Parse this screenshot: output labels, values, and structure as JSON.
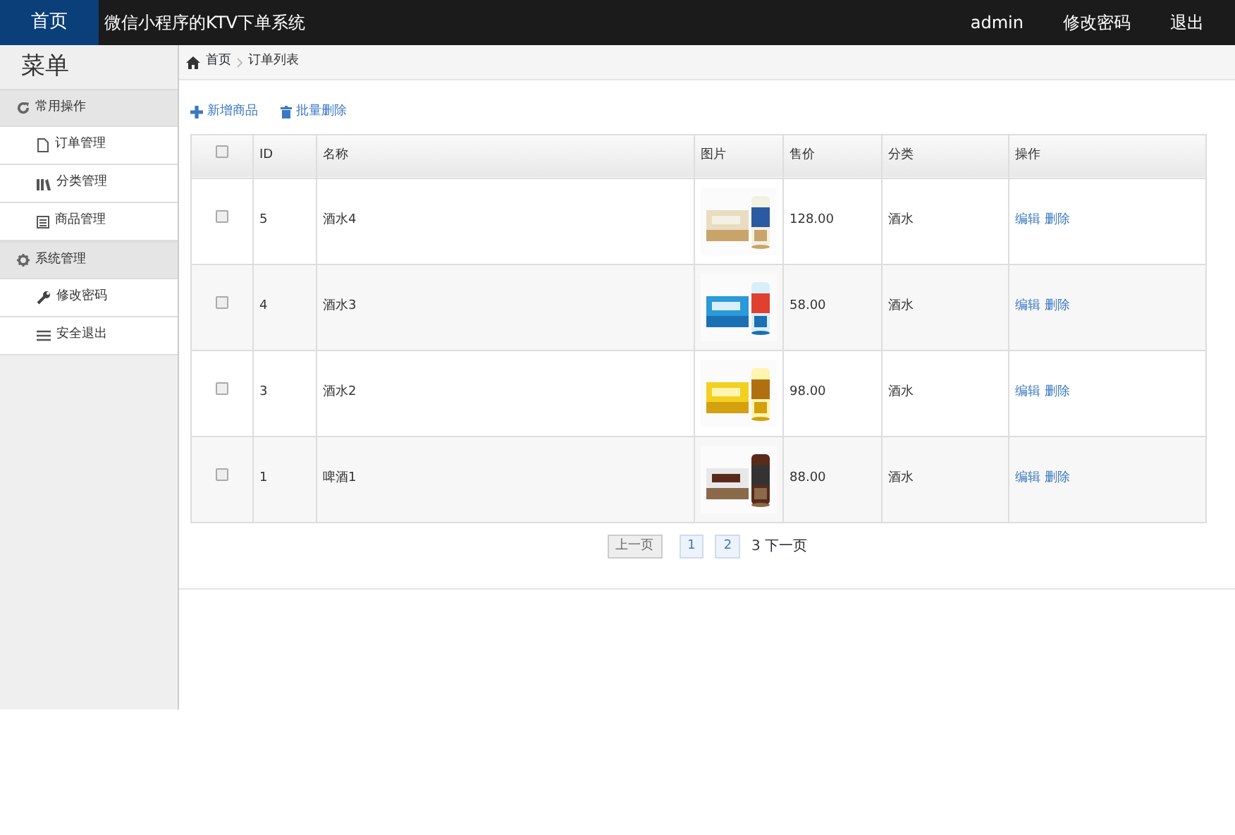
{
  "navbar": {
    "home": "首页",
    "title": "微信小程序的KTV下单系统",
    "links": [
      "admin",
      "修改密码",
      "退出"
    ]
  },
  "sidebar": {
    "title": "菜单",
    "groups": [
      {
        "label": "常用操作",
        "items": [
          {
            "label": "订单管理"
          },
          {
            "label": "分类管理"
          },
          {
            "label": "商品管理"
          }
        ]
      },
      {
        "label": "系统管理",
        "items": [
          {
            "label": "修改密码"
          },
          {
            "label": "安全退出"
          }
        ]
      }
    ]
  },
  "breadcrumb": [
    "首页",
    "订单列表"
  ],
  "actions": [
    {
      "label": "新增商品"
    },
    {
      "label": "批量删除"
    }
  ],
  "table": {
    "select_all_checked": false,
    "columns": [
      "ID",
      "名称",
      "图片",
      "售价",
      "分类",
      "操作"
    ],
    "rows": [
      {
        "checked": false,
        "id": "5",
        "name": "酒水4",
        "image": {
          "kind": "picture"
        },
        "price": "128.00",
        "category": "酒水",
        "ops": [
          "编辑",
          "删除"
        ]
      },
      {
        "checked": false,
        "id": "4",
        "name": "酒水3",
        "image": {
          "kind": "picture"
        },
        "price": "58.00",
        "category": "酒水",
        "ops": [
          "编辑",
          "删除"
        ]
      },
      {
        "checked": false,
        "id": "3",
        "name": "酒水2",
        "image": {
          "kind": "picture"
        },
        "price": "98.00",
        "category": "酒水",
        "ops": [
          "编辑",
          "删除"
        ]
      },
      {
        "checked": false,
        "id": "1",
        "name": "啤酒1",
        "image": {
          "kind": "picture"
        },
        "price": "88.00",
        "category": "酒水",
        "ops": [
          "编辑",
          "删除"
        ]
      }
    ]
  },
  "pagination": {
    "prev": "上一页",
    "pages": [
      "1",
      "2"
    ],
    "current": "3",
    "next": "下一页"
  }
}
